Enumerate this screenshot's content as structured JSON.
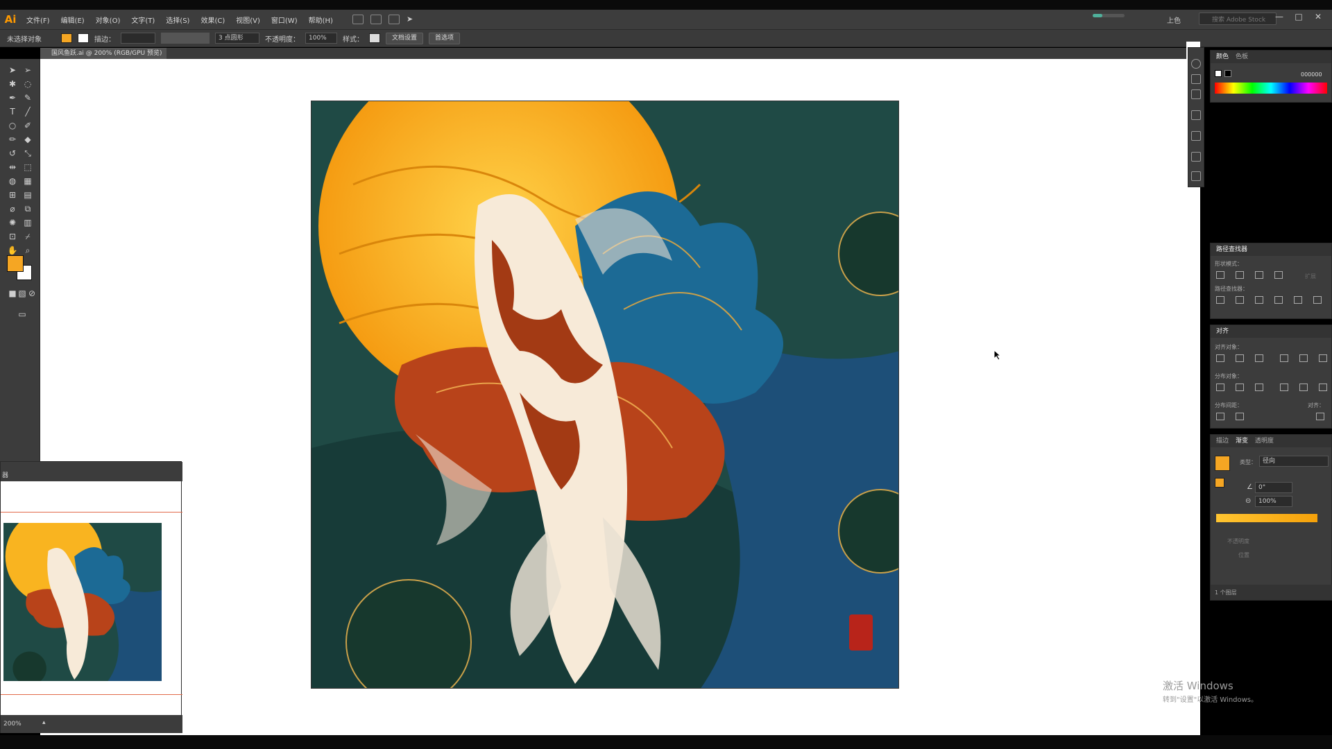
{
  "app": {
    "logo": "Ai",
    "menu": [
      "文件(F)",
      "编辑(E)",
      "对象(O)",
      "文字(T)",
      "选择(S)",
      "效果(C)",
      "视图(V)",
      "窗口(W)",
      "帮助(H)"
    ],
    "workspace": "上色",
    "stock_search_placeholder": "搜索 Adobe Stock",
    "window_buttons": [
      "—",
      "□",
      "✕"
    ]
  },
  "control_bar": {
    "selection": "未选择对象",
    "stroke_label": "描边：",
    "brush": "3 点圆形",
    "opacity_label": "不透明度：",
    "opacity_value": "100%",
    "style_label": "样式：",
    "doc_setup_button": "文档设置",
    "preferences_button": "首选项"
  },
  "document": {
    "tab_title": "国风鱼跃.ai @ 200% (RGB/GPU 预览)"
  },
  "navigator": {
    "title": "器",
    "zoom": "200%"
  },
  "panels": {
    "color": {
      "tabs": [
        "颜色",
        "色板"
      ],
      "hex": "000000"
    },
    "pathfinder": {
      "title": "路径查找器",
      "shape_modes": "形状模式：",
      "pathfinders": "路径查找器：",
      "expand": "扩展"
    },
    "align": {
      "title": "对齐",
      "align_objects": "对齐对象：",
      "distribute_objects": "分布对象：",
      "distribute_spacing": "分布间距：",
      "align_to": "对齐："
    },
    "gradient": {
      "tabs": [
        "描边",
        "渐变",
        "透明度"
      ],
      "type_label": "类型：",
      "type_value": "径向",
      "angle": "0°",
      "aspect": "100%",
      "opacity_label": "不透明度",
      "location_label": "位置"
    },
    "layers": {
      "count": "1 个图层"
    }
  },
  "watermark": {
    "line1": "激活 Windows",
    "line2": "转到\"设置\"以激活 Windows。"
  },
  "colors": {
    "ui_dark": "#3c3c3c",
    "fill": "#f5a623",
    "art_orange": "#f7b21f",
    "art_teal": "#1f4a45",
    "art_blue": "#1d5e86",
    "art_red": "#b8431a"
  }
}
